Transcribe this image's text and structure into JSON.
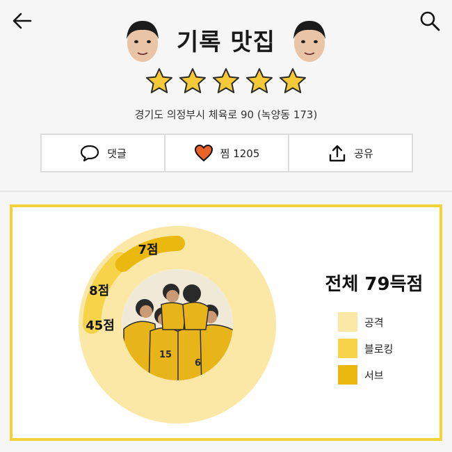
{
  "header": {
    "back_icon": "arrow-left-icon",
    "search_icon": "search-icon",
    "title": "기록 맛집"
  },
  "rating": {
    "stars": 5,
    "max": 5
  },
  "address": "경기도 의정부시 체육로 90 (녹양동 173)",
  "actions": [
    {
      "icon": "speech-bubble-icon",
      "label": "댓글"
    },
    {
      "icon": "heart-icon",
      "label": "찜 1205",
      "color": "#e8622a"
    },
    {
      "icon": "share-upload-icon",
      "label": "공유"
    }
  ],
  "stats": {
    "total_label": "전체 79득점",
    "colors": {
      "attack": "#fbe8a6",
      "block": "#f7d349",
      "serve": "#ebb810",
      "border": "#f2d43a"
    },
    "legend": [
      {
        "key": "attack",
        "label": "공격"
      },
      {
        "key": "block",
        "label": "블로킹"
      },
      {
        "key": "serve",
        "label": "서브"
      }
    ],
    "segment_labels": {
      "attack": "45점",
      "block": "8점",
      "serve": "7점"
    }
  },
  "chart_data": {
    "type": "pie",
    "title": "전체 79득점",
    "categories": [
      "공격",
      "블로킹",
      "서브"
    ],
    "values": [
      45,
      8,
      7
    ],
    "legend": "right"
  }
}
